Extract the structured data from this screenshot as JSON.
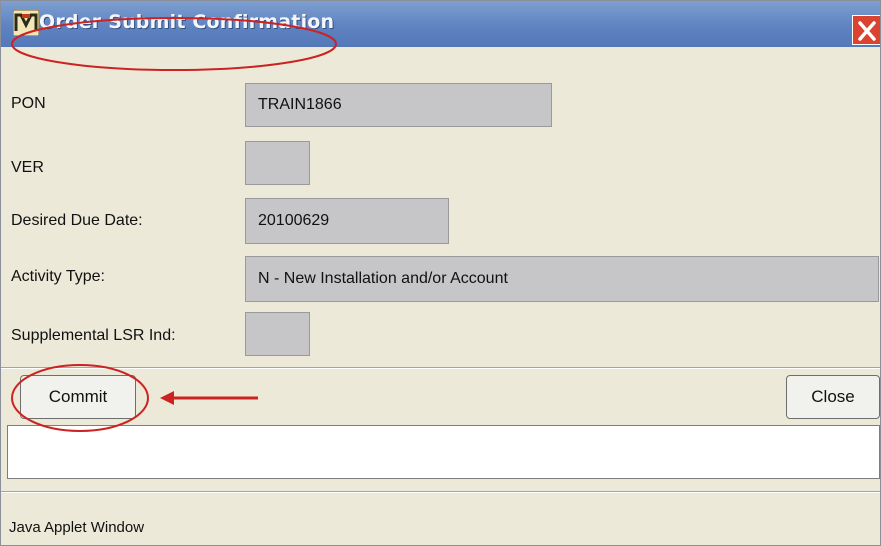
{
  "window": {
    "title": "Order Submit Confirmation",
    "close_glyph": "X"
  },
  "form": {
    "pon": {
      "label": "PON",
      "value": "TRAIN1866"
    },
    "ver": {
      "label": "VER",
      "value": ""
    },
    "desired_due_date": {
      "label": "Desired Due Date:",
      "value": "20100629"
    },
    "activity_type": {
      "label": "Activity Type:",
      "value": "N - New Installation and/or Account"
    },
    "supplemental_lsr_ind": {
      "label": "Supplemental LSR Ind:",
      "value": ""
    }
  },
  "buttons": {
    "commit": "Commit",
    "close": "Close"
  },
  "message_area": {
    "value": ""
  },
  "status_bar": {
    "text": "Java Applet Window"
  },
  "annotations": {
    "color": "#cc2222",
    "circled_items": [
      "title",
      "commit-button"
    ],
    "arrow_target": "commit-button"
  },
  "colors": {
    "titlebar": "#5f83c1",
    "window_bg": "#ece9d8",
    "field_bg": "#c6c6c8",
    "close_button": "#d9432f"
  },
  "icons": {
    "app_icon": "app-logo-icon",
    "close_icon": "close-icon"
  }
}
